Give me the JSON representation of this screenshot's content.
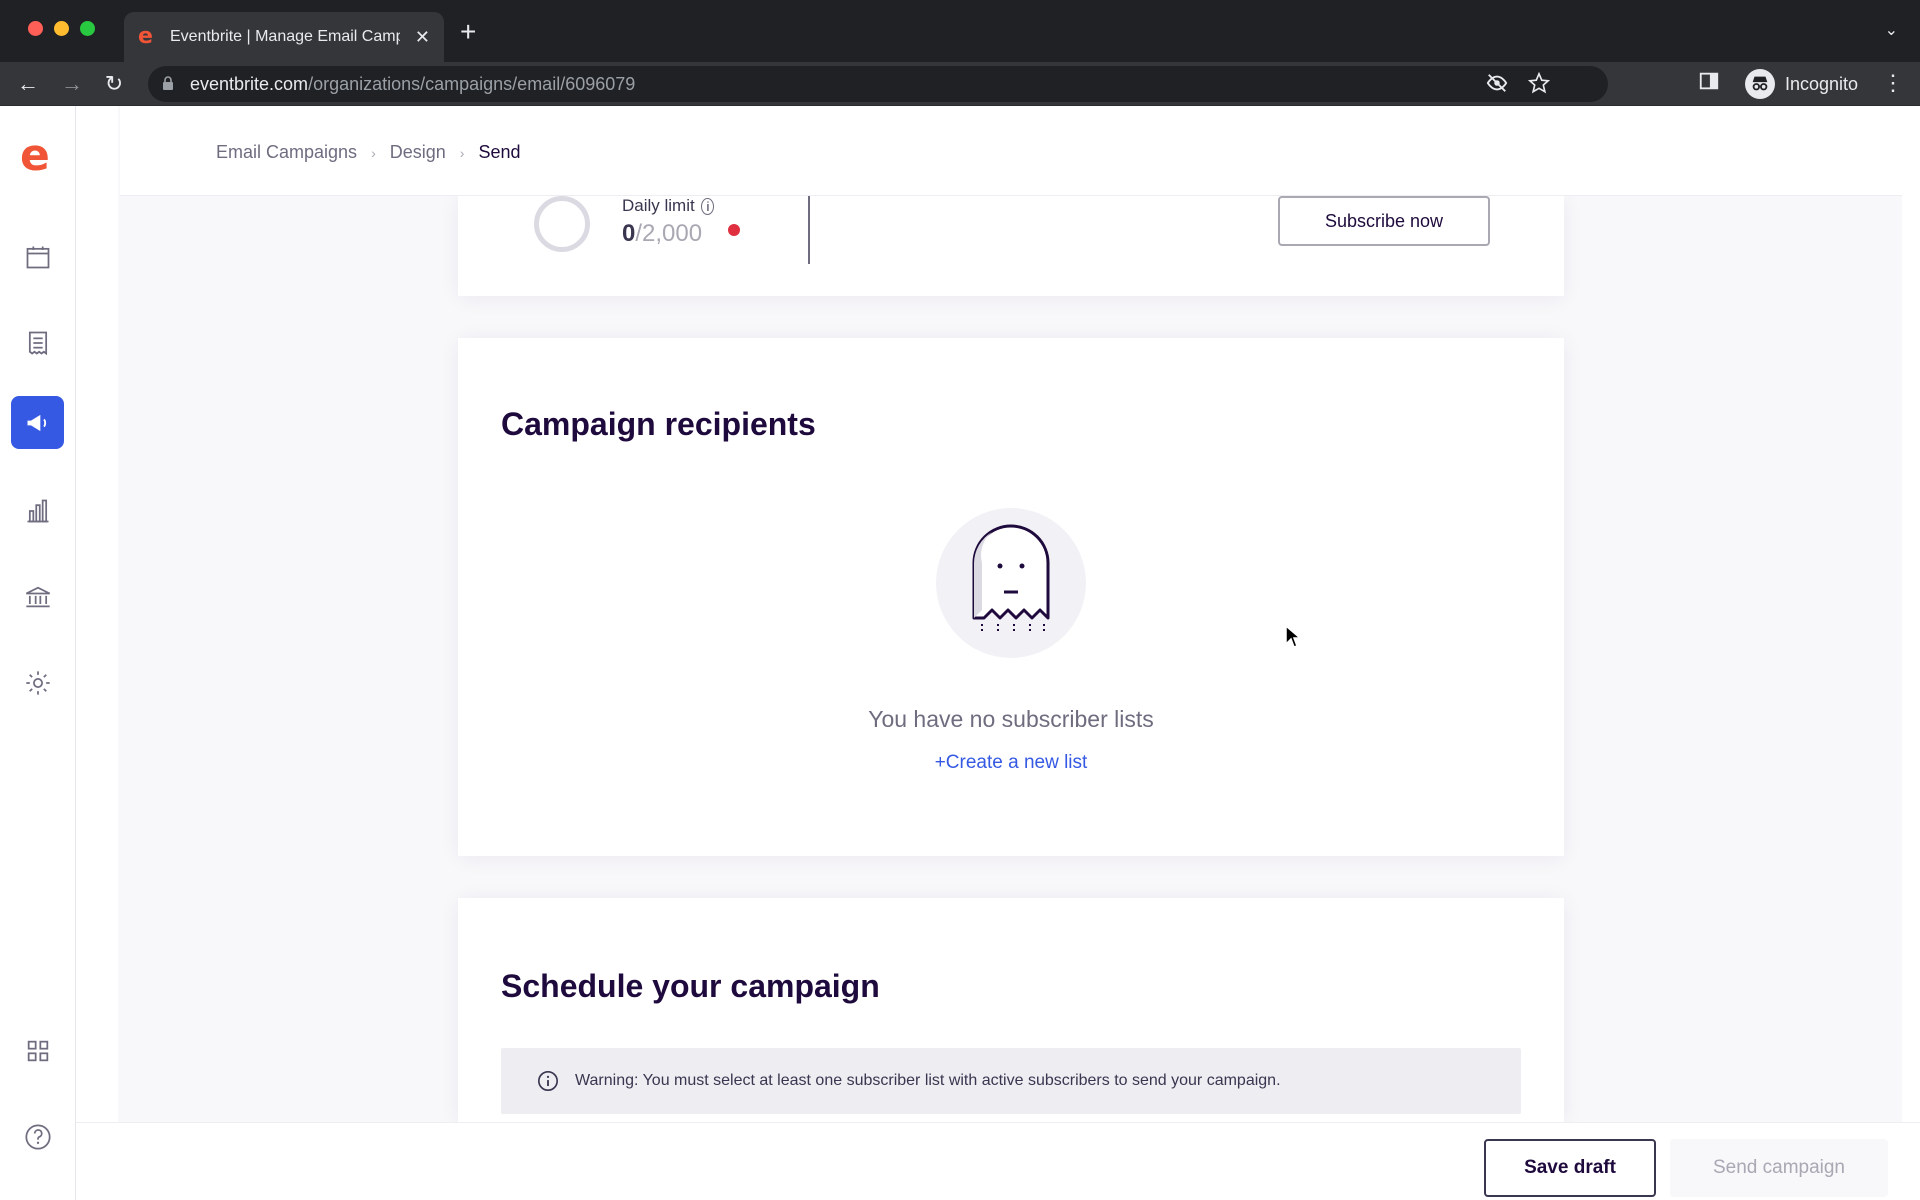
{
  "browser": {
    "tab_title": "Eventbrite | Manage Email Campaigns",
    "favicon_glyph": "e",
    "url_host": "eventbrite.com",
    "url_path": "/organizations/campaigns/email/6096079",
    "profile_label": "Incognito"
  },
  "breadcrumb": {
    "items": [
      "Email Campaigns",
      "Design",
      "Send"
    ]
  },
  "daily_limit": {
    "label": "Daily limit",
    "used": "0",
    "total": "/2,000",
    "subscribe_label": "Subscribe now"
  },
  "recipients": {
    "title": "Campaign recipients",
    "empty_message": "You have no subscriber lists",
    "create_label": "Create a new list",
    "create_prefix": "+"
  },
  "schedule": {
    "title": "Schedule your campaign",
    "warning": "Warning: You must select at least one subscriber list with active subscribers to send your campaign."
  },
  "footer": {
    "save_label": "Save draft",
    "send_label": "Send campaign"
  },
  "colors": {
    "brand": "#f05537",
    "accent": "#3659e3",
    "text_dark": "#1e0a3c",
    "alert": "#e02f3e"
  }
}
